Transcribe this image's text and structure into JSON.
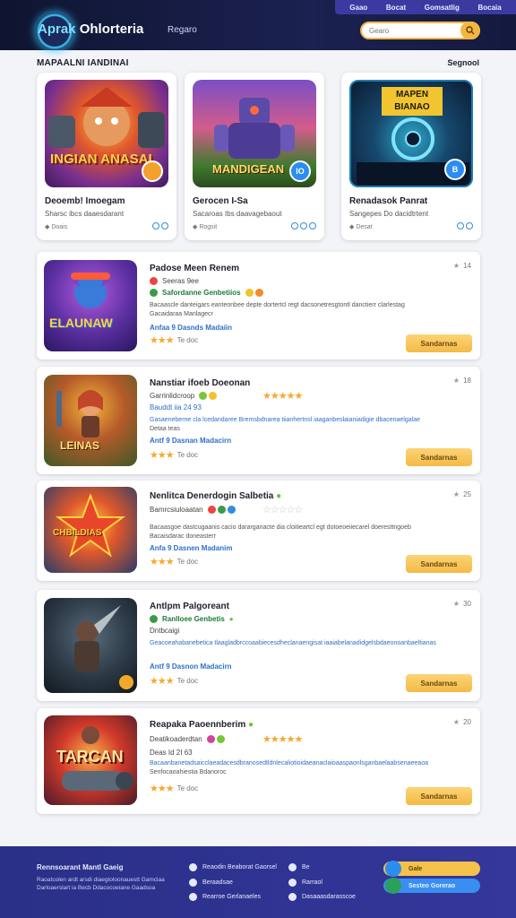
{
  "header": {
    "logo_main": "Aprak",
    "logo_accent": "Ohlorteria",
    "nav": "Regaro",
    "search_placeholder": "Gearo",
    "top_links": [
      "Gaao",
      "Bocat",
      "Gomsatlig",
      "Bocaia"
    ]
  },
  "section": {
    "title": "MAPAALNI IANDINAI",
    "more": "Segnool"
  },
  "featured": [
    {
      "art_text": "INGIAN ANASAI",
      "title": "Deoemb! Imoegam",
      "sub": "Sharsc ibcs daaesdarant",
      "meta": "Doais",
      "badge": ""
    },
    {
      "art_text": "MANDIGEAN",
      "title": "Gerocen I-Sa",
      "sub": "Sacaroas Ibs daavagebaout",
      "meta": "Rogsit",
      "badge": "IO"
    },
    {
      "art_text": "MAPEN BIANAO",
      "title": "Renadasok Panrat",
      "sub": "Sangepes Do dacidtrtent",
      "meta": "Desat",
      "badge": "B"
    }
  ],
  "list": [
    {
      "title": "Padose Meen Renem",
      "rating": "14",
      "line2": "Seeras 9ee",
      "line3": "Safordanne Genbetiios",
      "desc": [
        "Bacaascle danteigars eanteonbee depte dortertcl regt dacsonetresgtontl danctierr clarlestag",
        "Gacaidaraa Manlagecr"
      ],
      "tags": "Anfaa 9   Dasnds Madaiin",
      "stars_label": "Te doc",
      "cta": "Sandarnas"
    },
    {
      "title": "Nanstiar ifoeb Doeonan",
      "rating": "18",
      "line2": "Garrinlidcroop",
      "line3": "Bauddt iia 24 93",
      "desc": [
        "Gasaeneberne cla lcedandaree Bremsbdnarea tiianhertnsl iaaganbeslaianiadigie dbacenaelgalae",
        "Detaa teas"
      ],
      "tags": "Antf 9   Dasnan Madacirn",
      "stars_label": "Te doc",
      "cta": "Sandarnas"
    },
    {
      "title": "Nenlitca Denerdogin Salbetia",
      "rating": "25",
      "line2": "Bamrcsiuloaatan",
      "line3": "",
      "desc": [
        "Bacaasgoe dastcugaanis cacio dararganacte dia cloitieartcl egt dotoeoeiiecarel doeresttngoeb",
        "Bacaisdarac doneasterr"
      ],
      "tags": "Anfa 9   Dasnen Madanim",
      "stars_label": "Te doc",
      "cta": "Sandarnas"
    },
    {
      "title": "Antlpm Palgoreant",
      "rating": "30",
      "line2": "Ranlloee Genbetis",
      "line3": "Dntbcaigi",
      "desc": [
        "Geacoeahabanebetica tlaagladbrccoaabiecesdheclanaengisat iaaiabelanadidgelsbdaeonoanbaeltianas"
      ],
      "tags": "Antf 9   Dasnon Madacirn",
      "stars_label": "Te doc",
      "cta": "Sandarnas"
    },
    {
      "title": "Reapaka Paoennberim",
      "rating": "20",
      "line2": "Deatikoaderdtan",
      "line3": "Deas Id 2I 63",
      "desc": [
        "Bacaanbanetadsaicclaeadacesdbranosedtldnlecaliotioidaeanaclaioaaspaonlsganbaelaabsenaeeaoa",
        "Senfocaoahiestia Bdanoroc"
      ],
      "tags": "",
      "stars_label": "Te doc",
      "cta": "Sandarnas"
    }
  ],
  "footer": {
    "title": "Rennsoarant Mantl Gaeig",
    "text": "Raoatcolen ardt arsdi diaegtoloonauestt Gamclaa Darloaerslart ia Becb Ddacocoeiane Gaadsoa",
    "links": [
      "Reaodin Beaborat Gaorsel",
      "Beraadsae",
      "Rearroe Gerlanaeles"
    ],
    "links2": [
      "Be",
      "Rarraol",
      "Dasaaasdarasscoe"
    ],
    "btn1": "Gale",
    "btn2": "Sesteo Gorerao"
  },
  "colors": {
    "accent": "#f4ba45",
    "brand": "#2a2f87",
    "link": "#2f6fc8"
  }
}
